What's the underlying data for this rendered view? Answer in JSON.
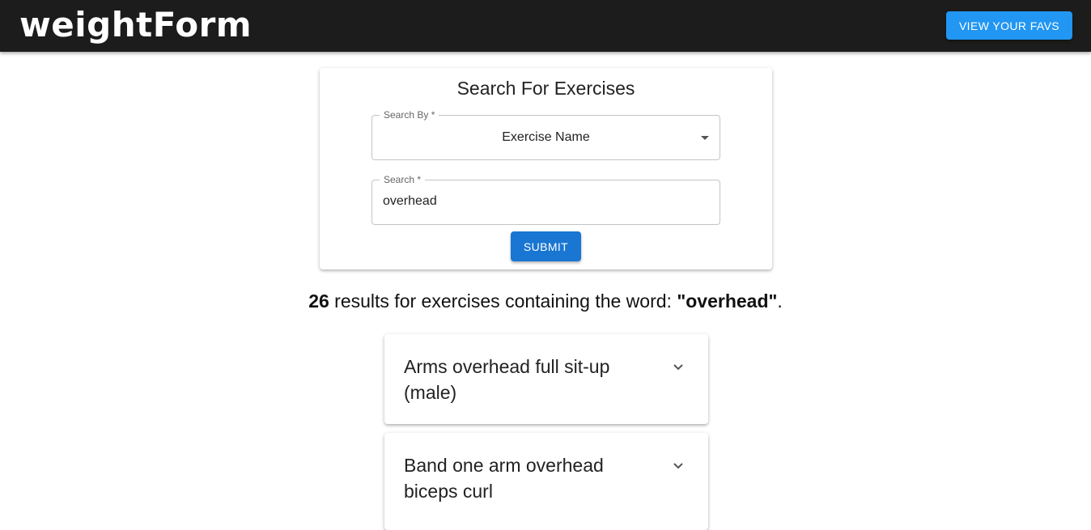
{
  "header": {
    "logo": "weightForm",
    "favs_button": "VIEW YOUR FAVS"
  },
  "search_card": {
    "title": "Search For Exercises",
    "search_by": {
      "label": "Search By *",
      "value": "Exercise Name"
    },
    "search": {
      "label": "Search *",
      "value": "overhead"
    },
    "submit_label": "SUBMIT"
  },
  "results": {
    "count": "26",
    "text_middle": " results for exercises containing the word: ",
    "term": "\"overhead\"",
    "suffix": ".",
    "items": [
      {
        "title": "Arms overhead full sit-up (male)",
        "icon": "chevron-down-icon"
      },
      {
        "title": "Band one arm overhead biceps curl",
        "icon": "chevron-down-icon"
      }
    ]
  },
  "colors": {
    "appbar": "#1c1c1c",
    "favs_button": "#2196f3",
    "submit_button": "#1976d2"
  }
}
